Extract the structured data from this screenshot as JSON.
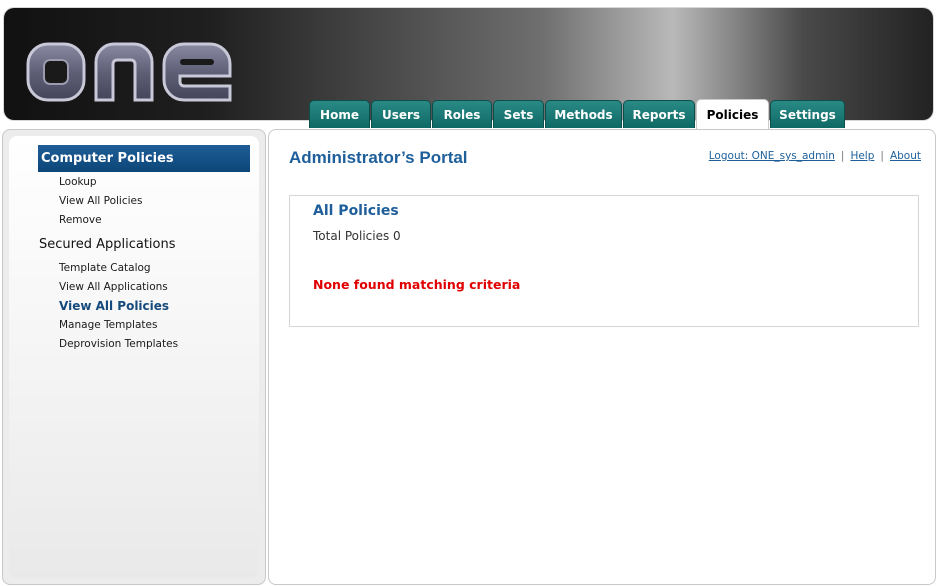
{
  "header": {
    "logo_text": "one"
  },
  "tabs": [
    {
      "label": "Home"
    },
    {
      "label": "Users"
    },
    {
      "label": "Roles"
    },
    {
      "label": "Sets"
    },
    {
      "label": "Methods"
    },
    {
      "label": "Reports"
    },
    {
      "label": "Policies",
      "active": true
    },
    {
      "label": "Settings"
    }
  ],
  "sidebar": {
    "section_title": "Computer Policies",
    "section_items": [
      "Lookup",
      "View All Policies",
      "Remove"
    ],
    "group_title": "Secured Applications",
    "group_items": [
      "Template Catalog",
      "View All Applications",
      "View All Policies",
      "Manage Templates",
      "Deprovision Templates"
    ],
    "current_item": "View All Policies"
  },
  "main": {
    "title": "Administrator’s Portal",
    "links": {
      "logout": "Logout: ONE_sys_admin",
      "help": "Help",
      "about": "About",
      "separator": "|"
    },
    "box": {
      "title": "All Policies",
      "total": "Total Policies 0",
      "message": "None found matching criteria"
    }
  },
  "colors": {
    "tab": "#0f6965",
    "accent_blue": "#1e5f9b",
    "error_red": "#e00000"
  }
}
